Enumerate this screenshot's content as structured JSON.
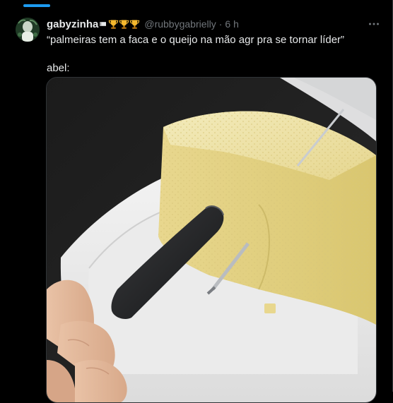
{
  "tweet": {
    "author": {
      "display_name": "gabyzinha",
      "name_emoji": [
        "trophy",
        "trophy",
        "trophy"
      ],
      "handle": "@rubbygabrielly",
      "separator": "·",
      "time": "6 h"
    },
    "text": {
      "line1": "“palmeiras tem a faca e o queijo na mão agr pra se tornar líder”",
      "line2": "abel:"
    },
    "media": {
      "icon": "photo-cheese-knife"
    },
    "more_icon": "more-horizontal-icon"
  },
  "colors": {
    "background": "#000000",
    "text": "#e7e9ea",
    "muted": "#71767b",
    "accent": "#1d9bf0",
    "border": "#2f3336"
  }
}
